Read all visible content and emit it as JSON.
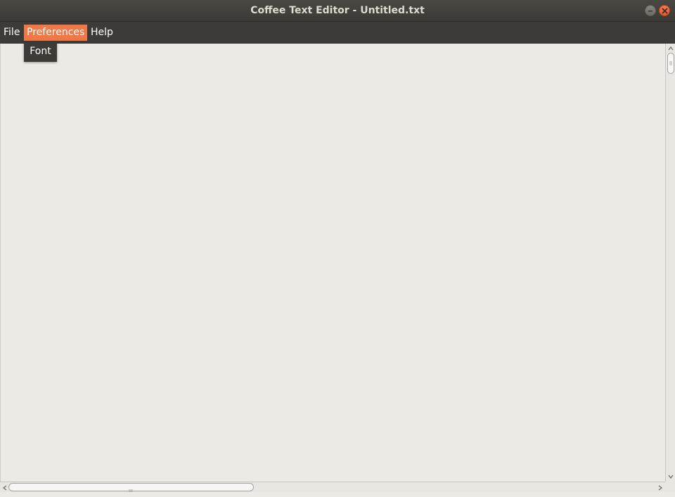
{
  "window": {
    "title": "Coffee Text Editor - Untitled.txt",
    "minimize_icon": "minimize-icon",
    "close_icon": "close-icon"
  },
  "menubar": {
    "items": [
      {
        "label": "File",
        "active": false
      },
      {
        "label": "Preferences",
        "active": true
      },
      {
        "label": "Help",
        "active": false
      }
    ]
  },
  "dropdown": {
    "parent": "Preferences",
    "items": [
      {
        "label": "Font"
      }
    ]
  },
  "editor": {
    "content": ""
  },
  "colors": {
    "accent": "#f07746",
    "menubar": "#3c3b37",
    "editor_bg": "#edeae6",
    "close_button": "#e55b2c"
  }
}
